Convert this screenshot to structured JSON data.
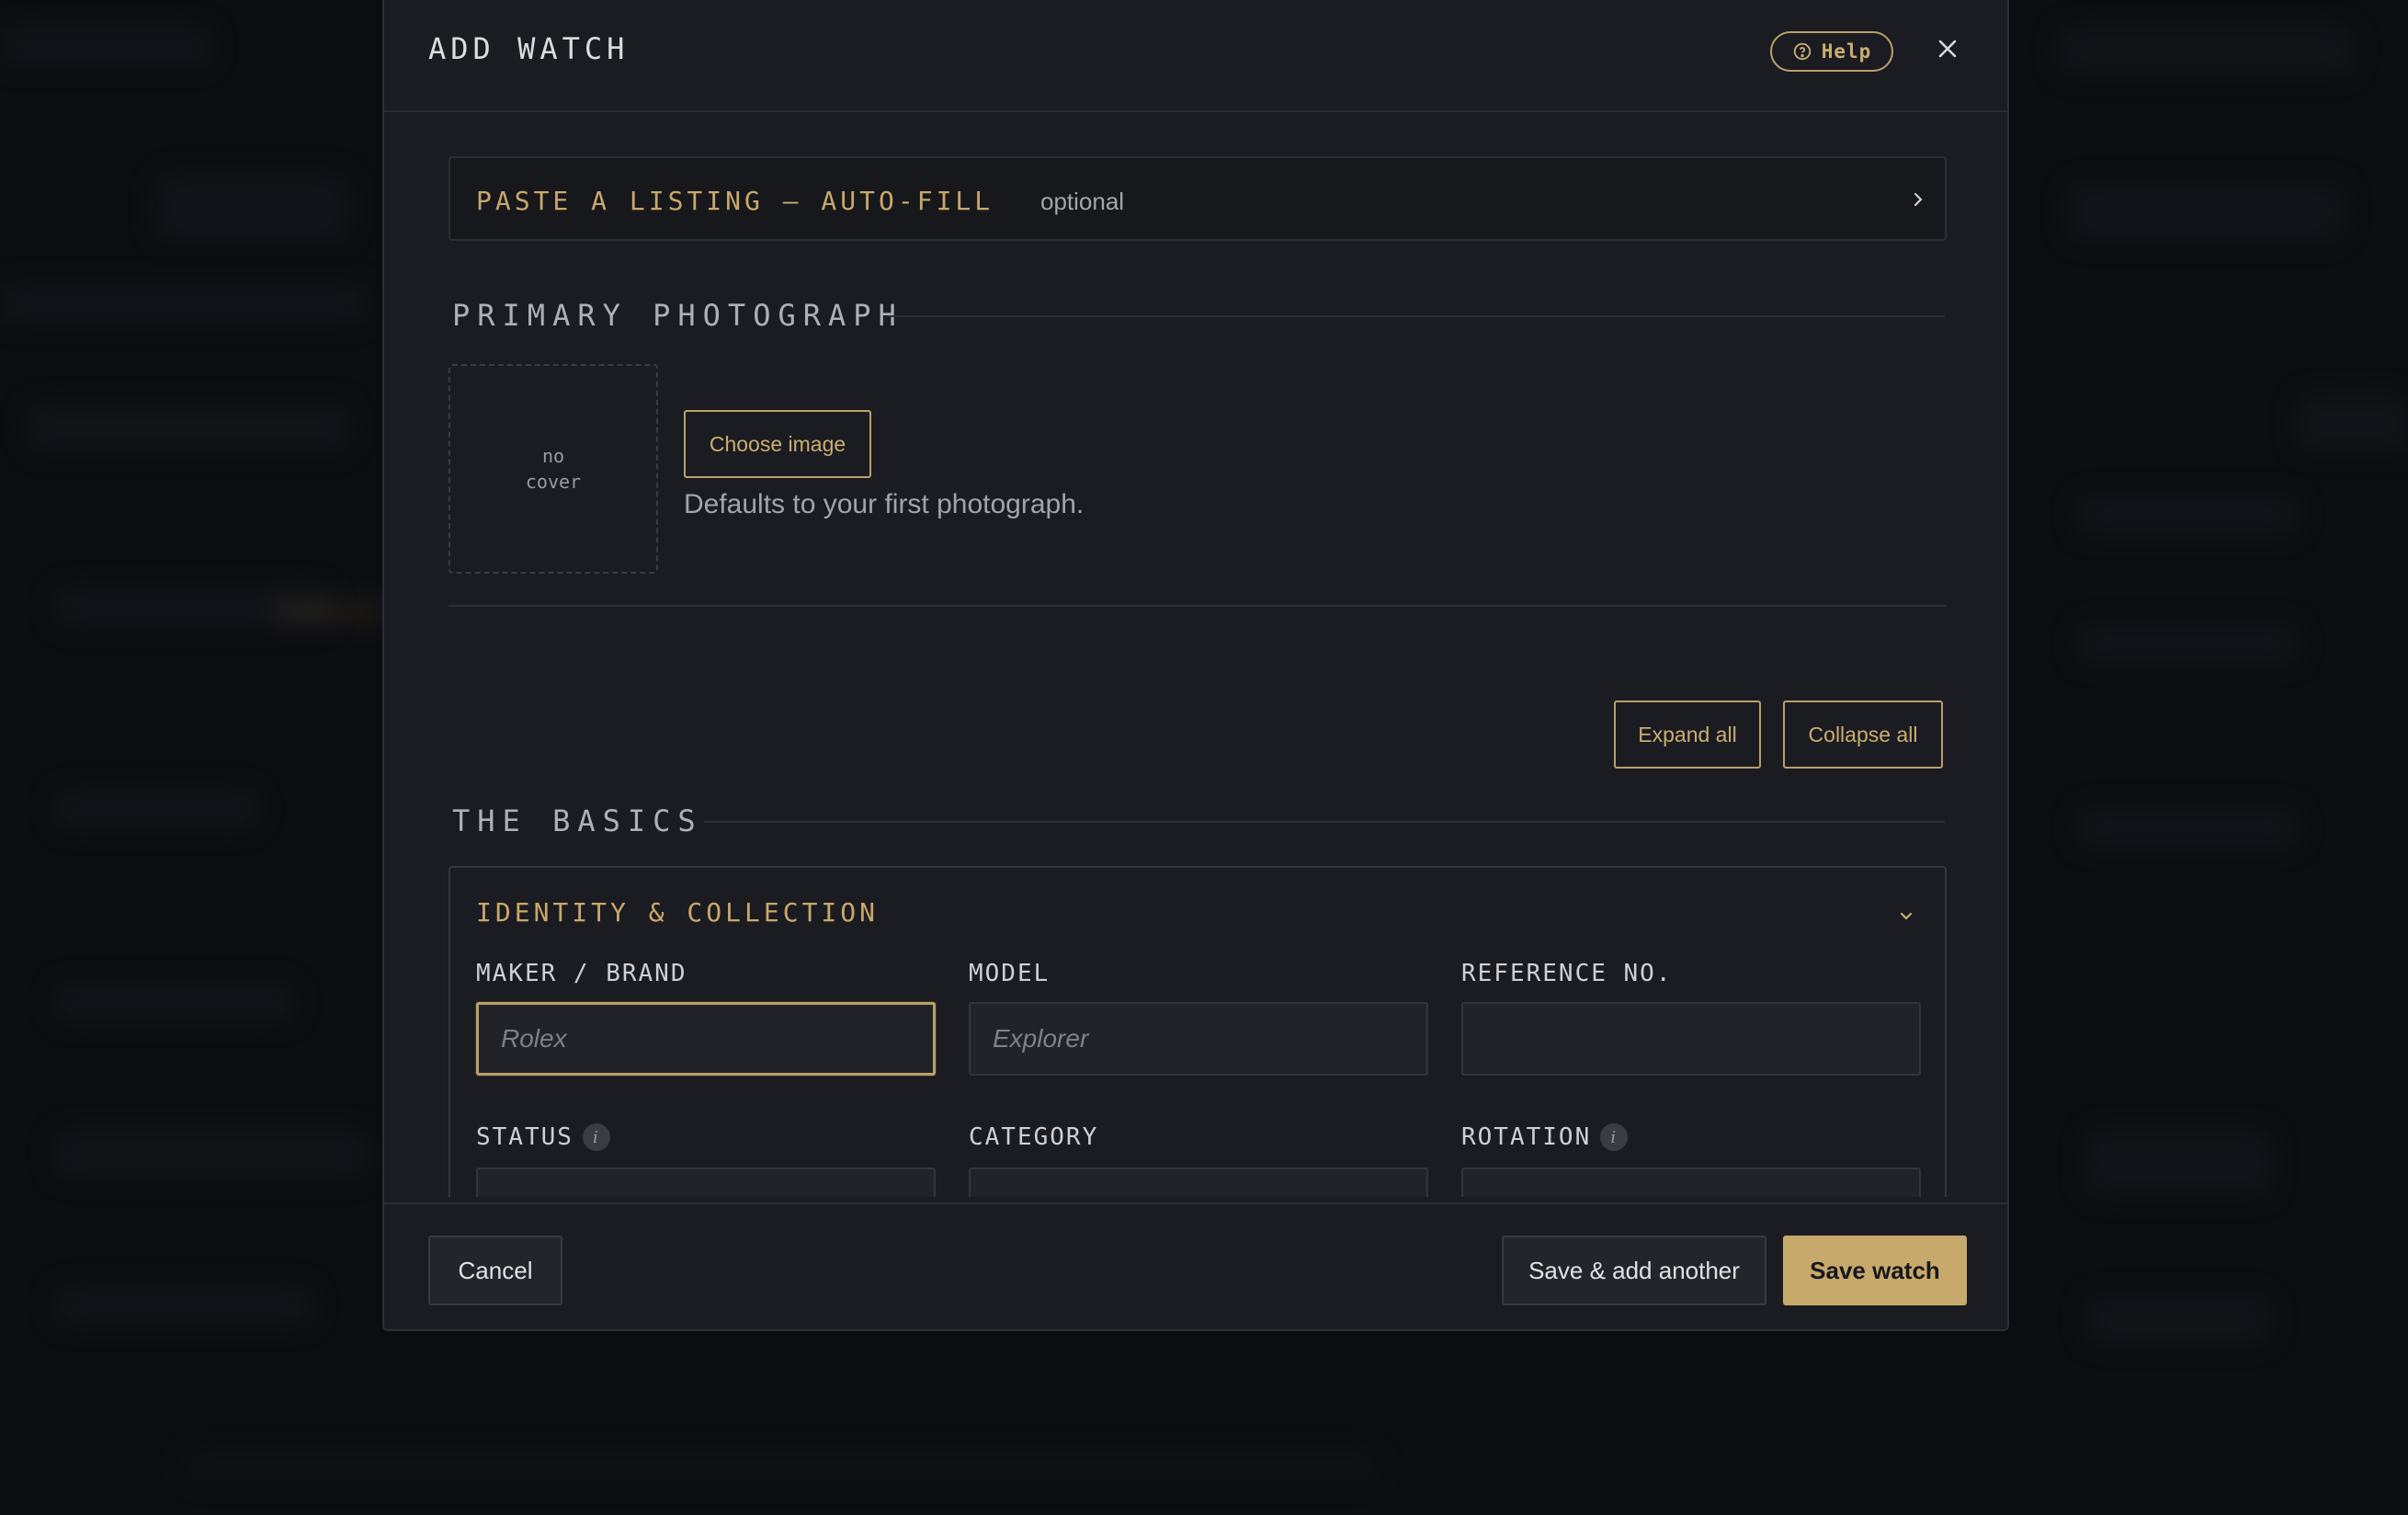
{
  "modal": {
    "title": "ADD WATCH",
    "help_label": "Help"
  },
  "autofill": {
    "label": "PASTE A LISTING — AUTO-FILL",
    "optional": "optional"
  },
  "photo_section": {
    "title": "PRIMARY PHOTOGRAPH",
    "cover_line1": "no",
    "cover_line2": "cover",
    "choose_label": "Choose image",
    "hint": "Defaults to your first photograph."
  },
  "controls": {
    "expand_all": "Expand all",
    "collapse_all": "Collapse all"
  },
  "basics": {
    "title": "THE BASICS",
    "card_title": "IDENTITY & COLLECTION",
    "fields": {
      "maker": {
        "label": "MAKER / BRAND",
        "placeholder": "Rolex",
        "value": ""
      },
      "model": {
        "label": "MODEL",
        "placeholder": "Explorer",
        "value": ""
      },
      "reference": {
        "label": "REFERENCE NO.",
        "placeholder": "",
        "value": ""
      },
      "status": {
        "label": "STATUS"
      },
      "category": {
        "label": "CATEGORY"
      },
      "rotation": {
        "label": "ROTATION"
      }
    }
  },
  "footer": {
    "cancel": "Cancel",
    "save_another": "Save & add another",
    "save": "Save watch"
  },
  "colors": {
    "accent": "#c7a96b",
    "background": "#1b1c21",
    "backdrop": "#0c0d11"
  },
  "icons": [
    "help-circle-icon",
    "close-icon",
    "chevron-right-icon",
    "chevron-down-icon",
    "info-icon"
  ]
}
